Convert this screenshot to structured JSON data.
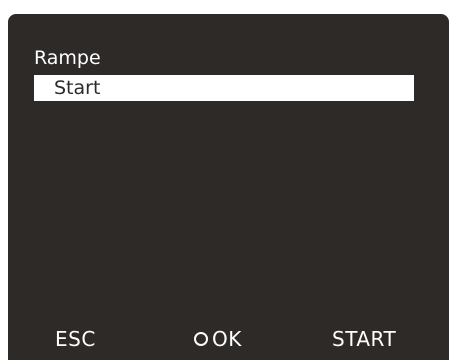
{
  "menu": {
    "title": "Rampe",
    "items": [
      {
        "label": "Start",
        "selected": true
      }
    ]
  },
  "softkeys": {
    "esc_label": "ESC",
    "ok_label": "OK",
    "ok_icon": "ring-icon",
    "start_label": "START"
  },
  "colors": {
    "background": "#2d2a28",
    "foreground": "#ffffff",
    "selection": "#ffffff"
  }
}
